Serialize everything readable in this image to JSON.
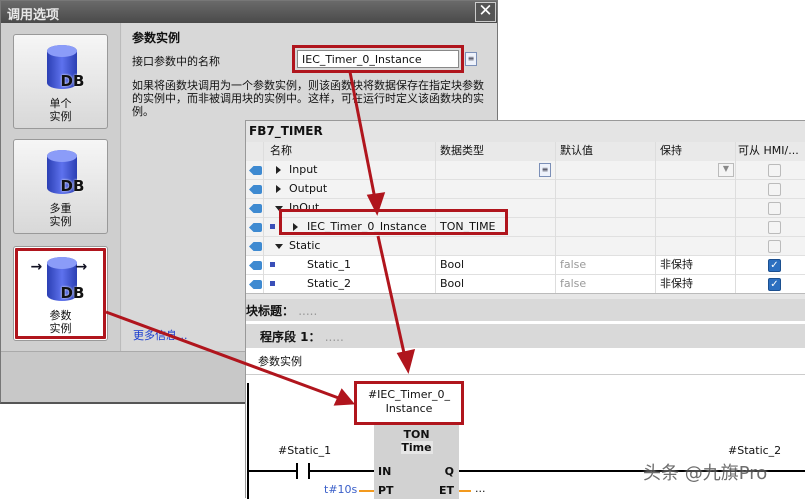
{
  "dialog": {
    "title": "调用选项",
    "close_icon": "close-icon",
    "options": [
      {
        "line1": "单个",
        "line2": "实例",
        "icon": "db-icon"
      },
      {
        "line1": "多重",
        "line2": "实例",
        "icon": "db-stack-icon"
      },
      {
        "line1": "参数",
        "line2": "实例",
        "icon": "db-arrows-icon",
        "selected": true
      }
    ],
    "db_label": "DB",
    "section_title": "参数实例",
    "field_label": "接口参数中的名称",
    "field_value": "IEC_Timer_0_Instance",
    "description": "如果将函数块调用为一个参数实例，则该函数块将数据保存在指定块参数的实例中，而非被调用块的实例中。这样，可在运行时定义该函数块的实例。",
    "more_info": "更多信息..."
  },
  "interface": {
    "title": "FB7_TIMER",
    "columns": [
      "名称",
      "数据类型",
      "默认值",
      "保持",
      "可从 HMI/..."
    ],
    "rows": [
      {
        "name": "Input",
        "type": "",
        "default": "",
        "retain": "",
        "hmi": false
      },
      {
        "name": "Output",
        "type": "",
        "default": "",
        "retain": "",
        "hmi": false
      },
      {
        "name": "InOut",
        "type": "",
        "default": "",
        "retain": "",
        "hmi": false
      },
      {
        "name": "IEC_Timer_0_Instance",
        "type": "TON_TIME",
        "default": "",
        "retain": "",
        "hmi": false
      },
      {
        "name": "Static",
        "type": "",
        "default": "",
        "retain": "",
        "hmi": false
      },
      {
        "name": "Static_1",
        "type": "Bool",
        "default": "false",
        "retain": "非保持",
        "hmi": true
      },
      {
        "name": "Static_2",
        "type": "Bool",
        "default": "false",
        "retain": "非保持",
        "hmi": true
      }
    ]
  },
  "editor": {
    "block_title": "块标题：",
    "block_title_comment": ".....",
    "network": "程序段 1：",
    "network_comment": ".....",
    "network_comment_text": "参数实例",
    "instance_line1": "#IEC_Timer_0_",
    "instance_line2": "Instance",
    "block_type": "TON",
    "block_subtype": "Time",
    "pin_in": "IN",
    "pin_pt": "PT",
    "pin_q": "Q",
    "pin_et": "ET",
    "contact_tag": "#Static_1",
    "coil_tag": "#Static_2",
    "pt_value": "t#10s",
    "et_value": "..."
  },
  "watermark": "头条 @九旗Pro",
  "colors": {
    "highlight": "#b0151d",
    "link": "#1a3ccf"
  }
}
